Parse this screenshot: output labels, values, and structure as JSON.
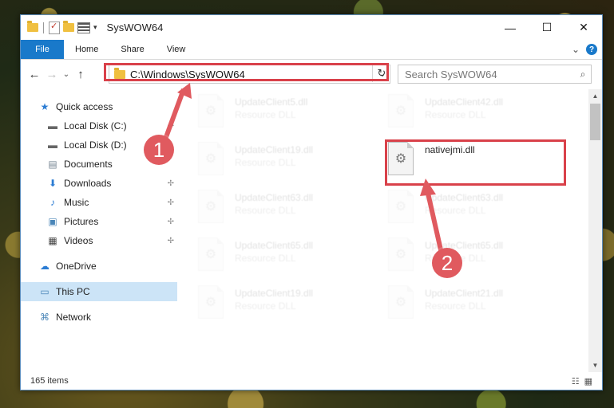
{
  "window": {
    "title": "SysWOW64"
  },
  "titlebar": {
    "minimize": "—",
    "maximize": "☐",
    "close": "✕"
  },
  "ribbon": {
    "tabs": [
      "File",
      "Home",
      "Share",
      "View"
    ],
    "expand": "⌄",
    "help": "?"
  },
  "address": {
    "path": "C:\\Windows\\SysWOW64",
    "back": "←",
    "forward": "→",
    "recent": "⌄",
    "up": "↑",
    "refresh": "↻",
    "dropdown": "⌄"
  },
  "search": {
    "placeholder": "Search SysWOW64",
    "icon": "⌕"
  },
  "sidebar": {
    "items": [
      {
        "label": "Quick access",
        "icon": "star-icon",
        "glyph": "★",
        "color": "#2b7cd3"
      },
      {
        "label": "Local Disk (C:)",
        "icon": "drive-icon",
        "glyph": "▬",
        "color": "#666666"
      },
      {
        "label": "Local Disk (D:)",
        "icon": "drive-icon",
        "glyph": "▬",
        "color": "#666666"
      },
      {
        "label": "Documents",
        "icon": "documents-icon",
        "glyph": "▤",
        "color": "#7a8896"
      },
      {
        "label": "Downloads",
        "icon": "download-icon",
        "glyph": "⬇",
        "color": "#2b7cd3"
      },
      {
        "label": "Music",
        "icon": "music-icon",
        "glyph": "♪",
        "color": "#2b7cd3"
      },
      {
        "label": "Pictures",
        "icon": "pictures-icon",
        "glyph": "▣",
        "color": "#4a86b8"
      },
      {
        "label": "Videos",
        "icon": "videos-icon",
        "glyph": "▦",
        "color": "#444444"
      },
      {
        "label": "OneDrive",
        "icon": "cloud-icon",
        "glyph": "☁",
        "color": "#2b7cd3"
      },
      {
        "label": "This PC",
        "icon": "computer-icon",
        "glyph": "▭",
        "color": "#4a86b8"
      },
      {
        "label": "Network",
        "icon": "network-icon",
        "glyph": "⌘",
        "color": "#4a86b8"
      }
    ],
    "pin": "📌"
  },
  "files": {
    "left": [
      {
        "name": "UpdateClient5.dll",
        "type": "Resource DLL"
      },
      {
        "name": "UpdateClient19.dll",
        "type": "Resource DLL"
      },
      {
        "name": "UpdateClient63.dll",
        "type": "Resource DLL"
      },
      {
        "name": "UpdateClient65.dll",
        "type": "Resource DLL"
      },
      {
        "name": "UpdateClient19.dll",
        "type": "Resource DLL"
      }
    ],
    "right": [
      {
        "name": "UpdateClient42.dll",
        "type": "Resource DLL"
      },
      {
        "name": "nativejmi.dll",
        "type": ""
      },
      {
        "name": "UpdateClient63.dll",
        "type": "Resource DLL"
      },
      {
        "name": "UpdateClient65.dll",
        "type": "Resource DLL"
      },
      {
        "name": "UpdateClient21.dll",
        "type": "Resource DLL"
      }
    ]
  },
  "status": {
    "items": "165 items"
  },
  "annotations": {
    "step1": "1",
    "step2": "2",
    "highlight_color": "#d9414a",
    "badge_color": "#e05a5f"
  },
  "colors": {
    "file_tab": "#1979ca",
    "selection": "#cce4f7"
  }
}
